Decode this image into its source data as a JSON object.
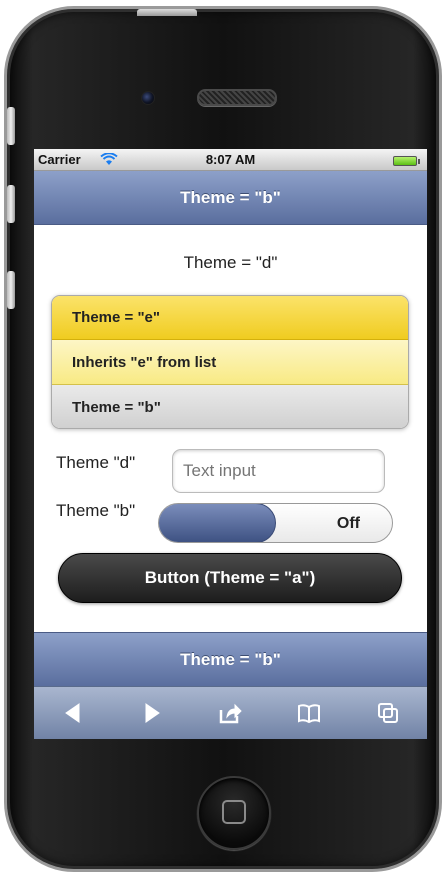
{
  "status_bar": {
    "carrier": "Carrier",
    "time": "8:07 AM"
  },
  "header": {
    "title": "Theme = \"b\""
  },
  "content": {
    "title": "Theme = \"d\"",
    "list": [
      {
        "label": "Theme = \"e\""
      },
      {
        "label": "Inherits \"e\" from list"
      },
      {
        "label": "Theme = \"b\""
      }
    ],
    "text_input": {
      "label": "Theme \"d\"",
      "placeholder": "Text input"
    },
    "toggle": {
      "label": "Theme \"b\"",
      "value_label": "Off"
    },
    "button": {
      "label": "Button (Theme = \"a\")"
    }
  },
  "footer": {
    "title": "Theme = \"b\""
  },
  "toolbar": {
    "items": [
      "back-icon",
      "forward-icon",
      "share-icon",
      "bookmarks-icon",
      "tabs-icon"
    ]
  },
  "colors": {
    "theme_b": "#5a6e9e",
    "theme_e": "#f0cc20",
    "theme_a": "#1d1d1d"
  }
}
